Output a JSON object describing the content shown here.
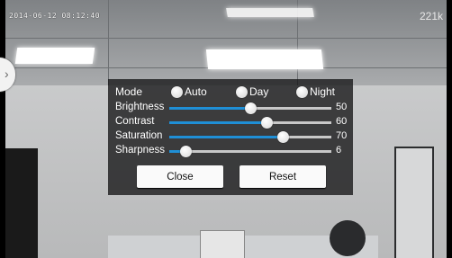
{
  "overlay": {
    "timestamp": "2014-06-12 08:12:40",
    "bitrate": "221k",
    "side_tab_glyph": "›"
  },
  "settings": {
    "mode_label": "Mode",
    "mode_options": [
      "Auto",
      "Day",
      "Night"
    ],
    "sliders": [
      {
        "label": "Brightness",
        "value": "50",
        "level": 0.5
      },
      {
        "label": "Contrast",
        "value": "60",
        "level": 0.6
      },
      {
        "label": "Saturation",
        "value": "70",
        "level": 0.7
      },
      {
        "label": "Sharpness",
        "value": "6",
        "level": 0.1
      }
    ],
    "close_label": "Close",
    "reset_label": "Reset"
  },
  "colors": {
    "accent": "#1f8fd6",
    "panel_bg": "rgba(20,20,22,0.78)"
  },
  "icons": {
    "side_tab": "chevron-right-icon",
    "radio": "radio-button-icon"
  }
}
